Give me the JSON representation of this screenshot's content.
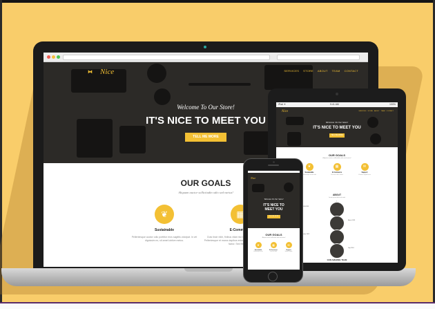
{
  "laptop": {
    "brand_name": "Nice",
    "brand_icon": "bow-tie-icon",
    "nav": [
      "SERVICES",
      "STORE",
      "ABOUT",
      "TEAM",
      "CONTACT"
    ],
    "hero_welcome": "Welcome To Our Store!",
    "hero_title": "IT'S NICE TO MEET YOU",
    "hero_button": "TELL ME MORE",
    "goals_title": "OUR GOALS",
    "goals_subtitle": "Aliquam auctor sollicitudin odio sed varius!",
    "goals": [
      {
        "icon": "leaf-icon",
        "glyph": "❦",
        "name": "Sustainable",
        "text": "Pellentesque auctor odio porttitor eros sagittis volutpat. In vel dignissim ex, sit amet lobtive metus."
      },
      {
        "icon": "shopping-basket-icon",
        "glyph": "▦",
        "name": "E-Commerce",
        "text": "Duis tincir nibh, finibus vitae nisi nec, porttitor molestie neque. Pellentesque et marcs dapibus enim. Cras acu a inin dolore lamulin factor. Sed fringrn est."
      }
    ]
  },
  "tablet": {
    "status_left": "iPad ✦",
    "status_time": "9:41 AM",
    "status_right": "100%",
    "brand_name": "Nice",
    "nav": [
      "SERVICES",
      "STORE",
      "ABOUT",
      "TEAM",
      "CONTACT"
    ],
    "hero_welcome": "Welcome To Our Store!",
    "hero_title": "IT'S NICE TO MEET YOU",
    "hero_button": "TELL ME MORE",
    "goals_title": "OUR GOALS",
    "goals_subtitle": "Aliquam auctor sollicitudin odio sed varius!",
    "goals": [
      {
        "icon": "leaf-icon",
        "glyph": "❦",
        "name": "Sustainable",
        "text": "Pellentesque auctor odio"
      },
      {
        "icon": "shopping-basket-icon",
        "glyph": "▦",
        "name": "E-Commerce",
        "text": "Duis tincir nibh, finibus"
      },
      {
        "icon": "chat-icon",
        "glyph": "✉",
        "name": "Support",
        "text": "Vivamus sagittis lacus"
      }
    ],
    "about_title": "ABOUT",
    "about_subtitle": "Lorem ipsum dolor sit amet",
    "timeline": [
      {
        "label": "2009-2011",
        "side": "left"
      },
      {
        "label": "March 2011",
        "side": "right"
      },
      {
        "label": "December 2012",
        "side": "left"
      },
      {
        "label": "July 2014",
        "side": "right"
      }
    ],
    "team_title": "OUR AMAZING TEAM"
  },
  "phone": {
    "brand_name": "Nice",
    "hero_welcome": "Welcome To Our Store!",
    "hero_title_line1": "IT'S NICE TO",
    "hero_title_line2": "MEET YOU",
    "hero_button": "TELL ME MORE",
    "goals_title": "OUR GOALS",
    "goals_subtitle": "Aliquam auctor sollicitudin odio sed varius!",
    "goals": [
      {
        "icon": "leaf-icon",
        "glyph": "❦",
        "name": "Sustainable",
        "text": "Pellentesque auctor"
      },
      {
        "icon": "shopping-basket-icon",
        "glyph": "▦",
        "name": "E-Commerce",
        "text": "Duis tincir nibh"
      },
      {
        "icon": "chat-icon",
        "glyph": "✉",
        "name": "Support",
        "text": "Vivamus sagittis"
      }
    ]
  },
  "colors": {
    "background": "#f9cd6a",
    "accent": "#f3c034",
    "device_dark": "#1c1c1c",
    "hero_dark": "#2c2a27"
  }
}
